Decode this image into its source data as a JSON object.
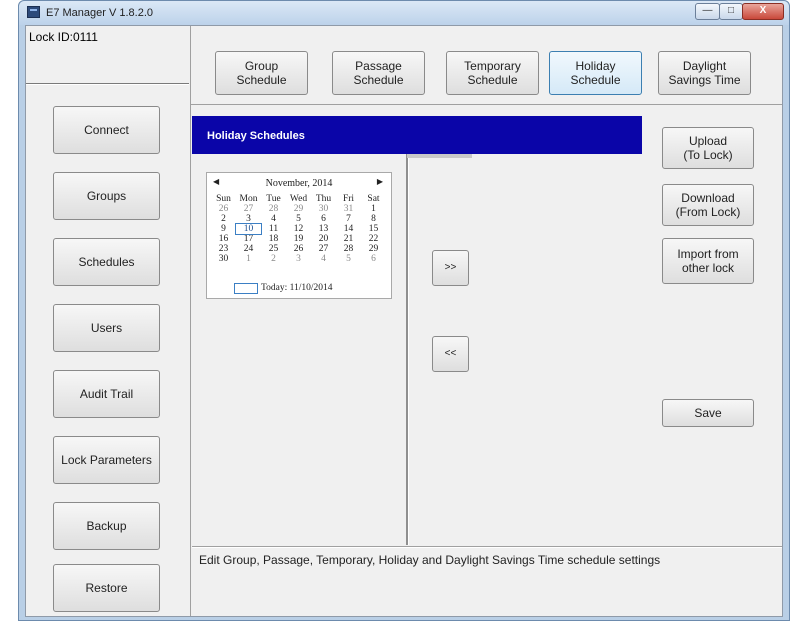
{
  "window": {
    "title": "E7 Manager V 1.8.2.0",
    "controls": {
      "minimize": "—",
      "maximize": "□",
      "close": "X"
    }
  },
  "lock": {
    "label": "Lock ID:",
    "value": "0111"
  },
  "nav": [
    "Connect",
    "Groups",
    "Schedules",
    "Users",
    "Audit Trail",
    "Lock Parameters",
    "Backup",
    "Restore"
  ],
  "tabs": [
    {
      "line1": "Group",
      "line2": "Schedule"
    },
    {
      "line1": "Passage",
      "line2": "Schedule"
    },
    {
      "line1": "Temporary",
      "line2": "Schedule"
    },
    {
      "line1": "Holiday",
      "line2": "Schedule"
    },
    {
      "line1": "Daylight",
      "line2": "Savings Time"
    }
  ],
  "selected_tab": "Holiday Schedule",
  "panel_title": "Holiday Schedules",
  "calendar": {
    "month_label": "November, 2014",
    "prev": "◀",
    "next": "▶",
    "weekdays": [
      "Sun",
      "Mon",
      "Tue",
      "Wed",
      "Thu",
      "Fri",
      "Sat"
    ],
    "weeks": [
      [
        "26",
        "27",
        "28",
        "29",
        "30",
        "31",
        "1"
      ],
      [
        "2",
        "3",
        "4",
        "5",
        "6",
        "7",
        "8"
      ],
      [
        "9",
        "10",
        "11",
        "12",
        "13",
        "14",
        "15"
      ],
      [
        "16",
        "17",
        "18",
        "19",
        "20",
        "21",
        "22"
      ],
      [
        "23",
        "24",
        "25",
        "26",
        "27",
        "28",
        "29"
      ],
      [
        "30",
        "1",
        "2",
        "3",
        "4",
        "5",
        "6"
      ]
    ],
    "today_label": "Today: 11/10/2014",
    "selected_day": "10"
  },
  "transfer": {
    "add": ">>",
    "remove": "<<"
  },
  "actions": {
    "upload": {
      "line1": "Upload",
      "line2": "(To Lock)"
    },
    "download": {
      "line1": "Download",
      "line2": "(From Lock)"
    },
    "import": {
      "line1": "Import from",
      "line2": "other lock"
    },
    "save": "Save"
  },
  "status": "Edit Group, Passage, Temporary, Holiday and Daylight Savings Time schedule settings"
}
